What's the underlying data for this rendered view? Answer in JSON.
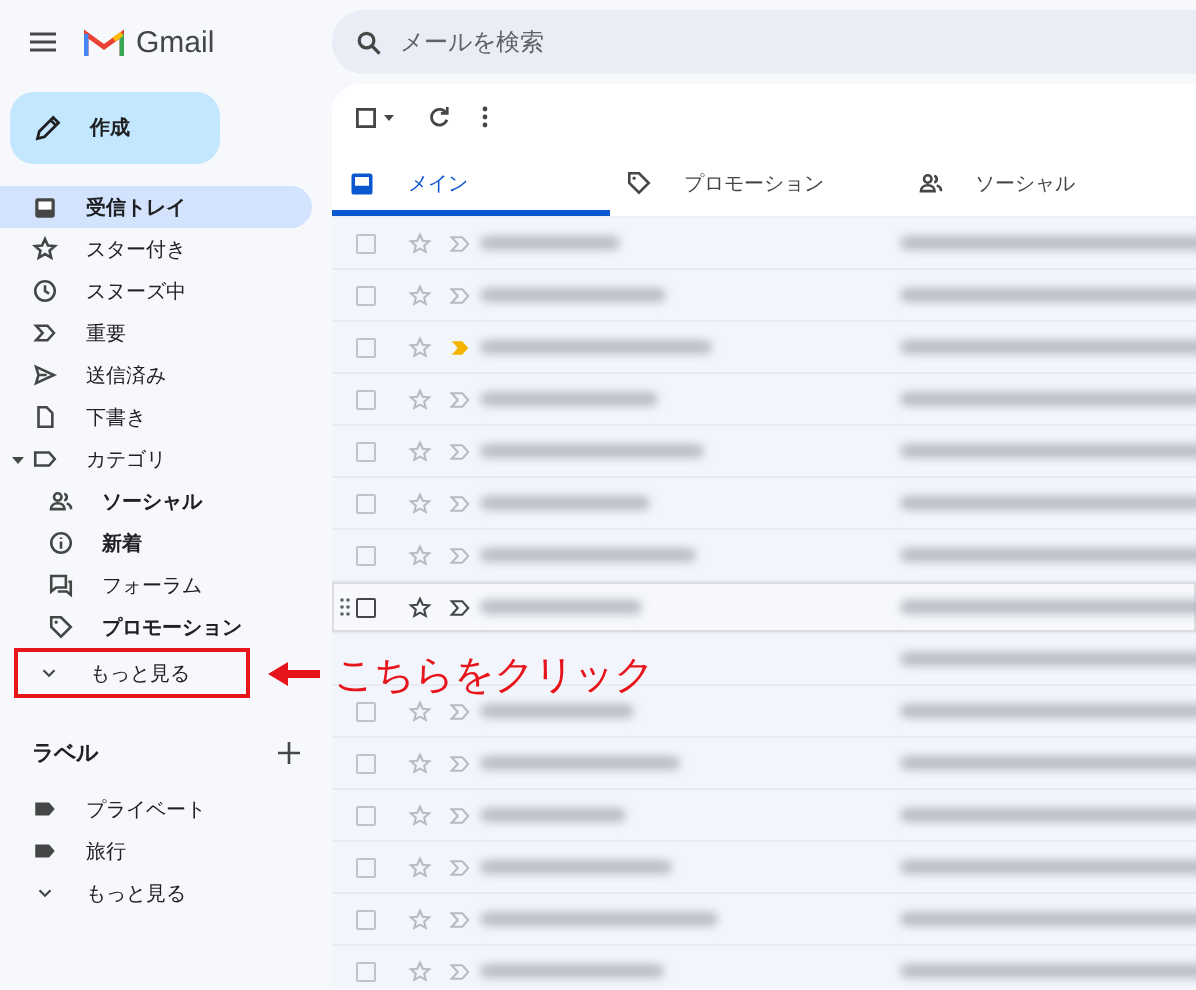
{
  "header": {
    "app_name": "Gmail",
    "search": {
      "placeholder": "メールを検索"
    }
  },
  "compose": {
    "label": "作成"
  },
  "nav": [
    {
      "label": "受信トレイ",
      "kind": "inbox",
      "bold": true,
      "selected": true
    },
    {
      "label": "スター付き",
      "kind": "star",
      "bold": false,
      "selected": false
    },
    {
      "label": "スヌーズ中",
      "kind": "clock",
      "bold": false,
      "selected": false
    },
    {
      "label": "重要",
      "kind": "important",
      "bold": false,
      "selected": false
    },
    {
      "label": "送信済み",
      "kind": "send",
      "bold": false,
      "selected": false
    },
    {
      "label": "下書き",
      "kind": "file",
      "bold": false,
      "selected": false
    },
    {
      "label": "カテゴリ",
      "kind": "label",
      "bold": false,
      "selected": false,
      "expanded": true,
      "children": [
        {
          "label": "ソーシャル",
          "kind": "people",
          "bold": true,
          "selected": false
        },
        {
          "label": "新着",
          "kind": "info",
          "bold": true,
          "selected": false
        },
        {
          "label": "フォーラム",
          "kind": "forum",
          "bold": false,
          "selected": false
        },
        {
          "label": "プロモーション",
          "kind": "tag",
          "bold": true,
          "selected": false
        }
      ]
    },
    {
      "label": "もっと見る",
      "kind": "chevron",
      "bold": false,
      "selected": false,
      "highlighted": true
    }
  ],
  "labels": {
    "title": "ラベル",
    "items": [
      {
        "label": "プライベート",
        "kind": "labelfill"
      },
      {
        "label": "旅行",
        "kind": "labelfill"
      },
      {
        "label": "もっと見る",
        "kind": "chevron"
      }
    ]
  },
  "tabs": [
    {
      "label": "メイン",
      "kind": "inbox",
      "selected": true
    },
    {
      "label": "プロモーション",
      "kind": "tag",
      "selected": false
    },
    {
      "label": "ソーシャル",
      "kind": "people",
      "selected": false
    }
  ],
  "mails": [
    {
      "important": false,
      "hovered": false
    },
    {
      "important": false,
      "hovered": false
    },
    {
      "important": true,
      "hovered": false
    },
    {
      "important": false,
      "hovered": false
    },
    {
      "important": false,
      "hovered": false
    },
    {
      "important": false,
      "hovered": false
    },
    {
      "important": false,
      "hovered": false
    },
    {
      "important": false,
      "hovered": true
    },
    {
      "hovered": false,
      "kind": "covered"
    },
    {
      "important": false,
      "hovered": false
    },
    {
      "important": false,
      "hovered": false
    },
    {
      "important": false,
      "hovered": false
    },
    {
      "important": false,
      "hovered": false
    },
    {
      "important": false,
      "hovered": false
    },
    {
      "important": false,
      "hovered": false
    }
  ],
  "callout": {
    "text": "こちらをクリック"
  }
}
